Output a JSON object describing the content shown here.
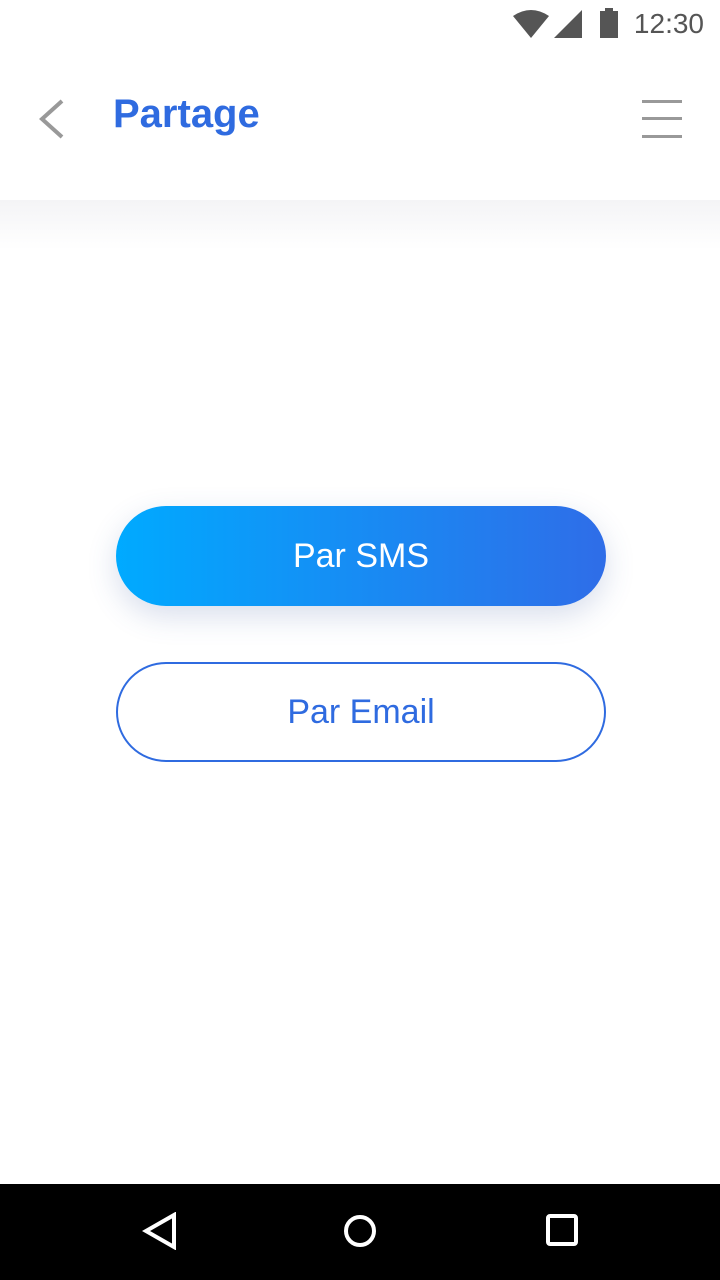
{
  "status": {
    "time": "12:30"
  },
  "header": {
    "title": "Partage"
  },
  "buttons": {
    "sms": "Par SMS",
    "email": "Par Email"
  },
  "colors": {
    "accent": "#2f6be0",
    "gradient_start": "#00aaff"
  }
}
